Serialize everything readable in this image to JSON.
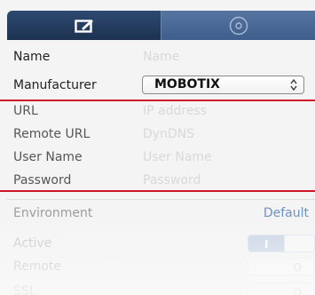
{
  "tabs": [
    {
      "icon": "edit-icon",
      "active": true
    },
    {
      "icon": "disc-icon",
      "active": false
    }
  ],
  "form": {
    "name": {
      "label": "Name",
      "placeholder": "Name"
    },
    "manufacturer": {
      "label": "Manufacturer",
      "value": "MOBOTIX"
    },
    "url": {
      "label": "URL",
      "placeholder": "IP address"
    },
    "remote_url": {
      "label": "Remote URL",
      "placeholder": "DynDNS"
    },
    "user_name": {
      "label": "User Name",
      "placeholder": "User Name"
    },
    "password": {
      "label": "Password",
      "placeholder": "Password"
    }
  },
  "environment": {
    "label": "Environment",
    "value": "Default"
  },
  "switches": [
    {
      "label": "Active",
      "state": "I"
    },
    {
      "label": "Remote",
      "state": "O"
    },
    {
      "label": "SSL",
      "state": "O"
    }
  ],
  "colors": {
    "tab_active": "#1c3150",
    "tab_inactive": "#3f5e8c",
    "highlight": "#d0142a",
    "link": "#6e8fbf"
  }
}
